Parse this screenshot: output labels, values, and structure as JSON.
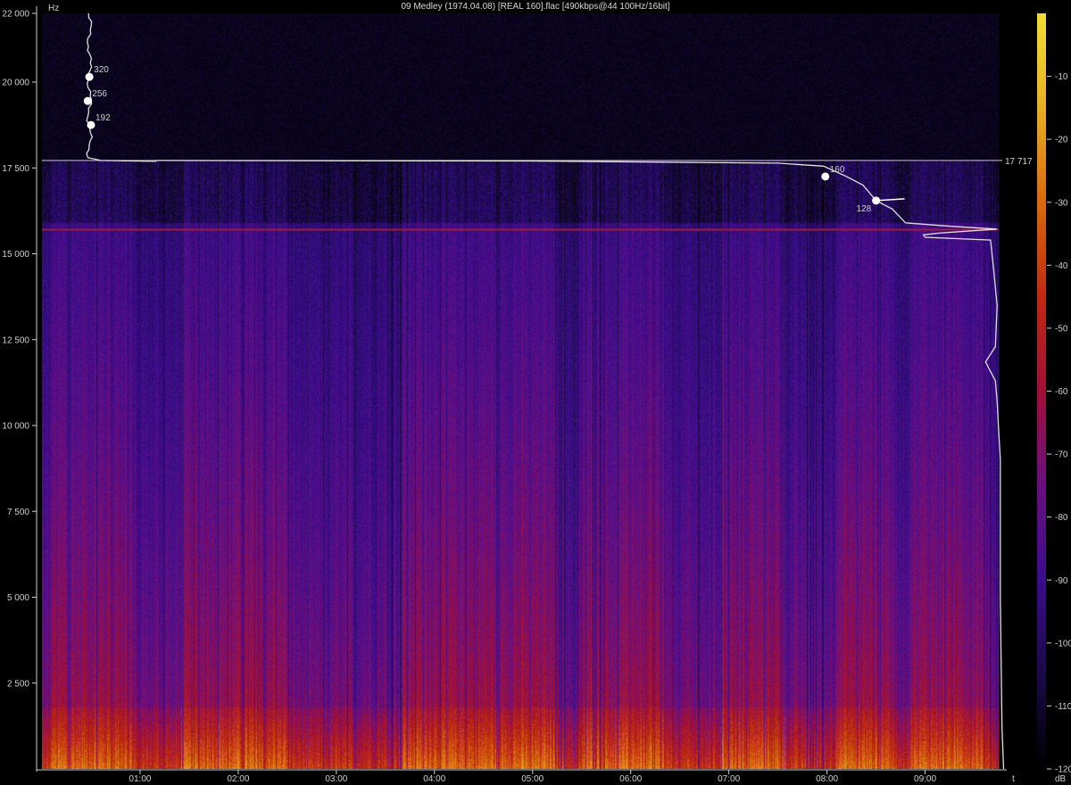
{
  "chart_data": {
    "type": "heatmap",
    "title": "09 Medley (1974.04.08) [REAL 160].flac [490kbps@44 100Hz/16bit]",
    "ylabel": "Hz",
    "xlabel": "t",
    "ylim": [
      0,
      22000
    ],
    "xlim_seconds": [
      0,
      585
    ],
    "y_ticks": [
      {
        "value": 2500,
        "label": "2 500"
      },
      {
        "value": 5000,
        "label": "5 000"
      },
      {
        "value": 7500,
        "label": "7 500"
      },
      {
        "value": 10000,
        "label": "10 000"
      },
      {
        "value": 12500,
        "label": "12 500"
      },
      {
        "value": 15000,
        "label": "15 000"
      },
      {
        "value": 17500,
        "label": "17 500"
      },
      {
        "value": 20000,
        "label": "20 000"
      },
      {
        "value": 22000,
        "label": "22 000"
      }
    ],
    "x_ticks": [
      {
        "value": 60,
        "label": "01:00"
      },
      {
        "value": 120,
        "label": "02:00"
      },
      {
        "value": 180,
        "label": "03:00"
      },
      {
        "value": 240,
        "label": "04:00"
      },
      {
        "value": 300,
        "label": "05:00"
      },
      {
        "value": 360,
        "label": "06:00"
      },
      {
        "value": 420,
        "label": "07:00"
      },
      {
        "value": 480,
        "label": "08:00"
      },
      {
        "value": 540,
        "label": "09:00"
      }
    ],
    "cutoff": {
      "value": 17717,
      "label": "17 717"
    },
    "highlight_line_hz": 15700,
    "colorbar": {
      "label": "dB",
      "range": [
        -120,
        0
      ],
      "ticks": [
        {
          "value": -10,
          "label": "-10"
        },
        {
          "value": -20,
          "label": "-20"
        },
        {
          "value": -30,
          "label": "-30"
        },
        {
          "value": -40,
          "label": "-40"
        },
        {
          "value": -50,
          "label": "-50"
        },
        {
          "value": -60,
          "label": "-60"
        },
        {
          "value": -70,
          "label": "-70"
        },
        {
          "value": -80,
          "label": "-80"
        },
        {
          "value": -90,
          "label": "-90"
        },
        {
          "value": -100,
          "label": "-100"
        },
        {
          "value": -110,
          "label": "-110"
        },
        {
          "value": -120,
          "label": "-120"
        }
      ],
      "colors": [
        "#000000",
        "#1a0a4a",
        "#3a0d8c",
        "#6a0f80",
        "#a0103a",
        "#c02a10",
        "#d86a10",
        "#e8b020",
        "#f0e030"
      ]
    },
    "bitrate_markers": [
      {
        "label": "320",
        "t": 29,
        "hz": 20150
      },
      {
        "label": "256",
        "t": 28,
        "hz": 19450
      },
      {
        "label": "192",
        "t": 30,
        "hz": 18750
      },
      {
        "label": "160",
        "t": 479,
        "hz": 17250
      },
      {
        "label": "128",
        "t": 510,
        "hz": 16550
      }
    ],
    "loud_time_bands_seconds": [
      5,
      55,
      85,
      150,
      220,
      278,
      280,
      315,
      330,
      380,
      415,
      455,
      485,
      520,
      530,
      575
    ]
  }
}
